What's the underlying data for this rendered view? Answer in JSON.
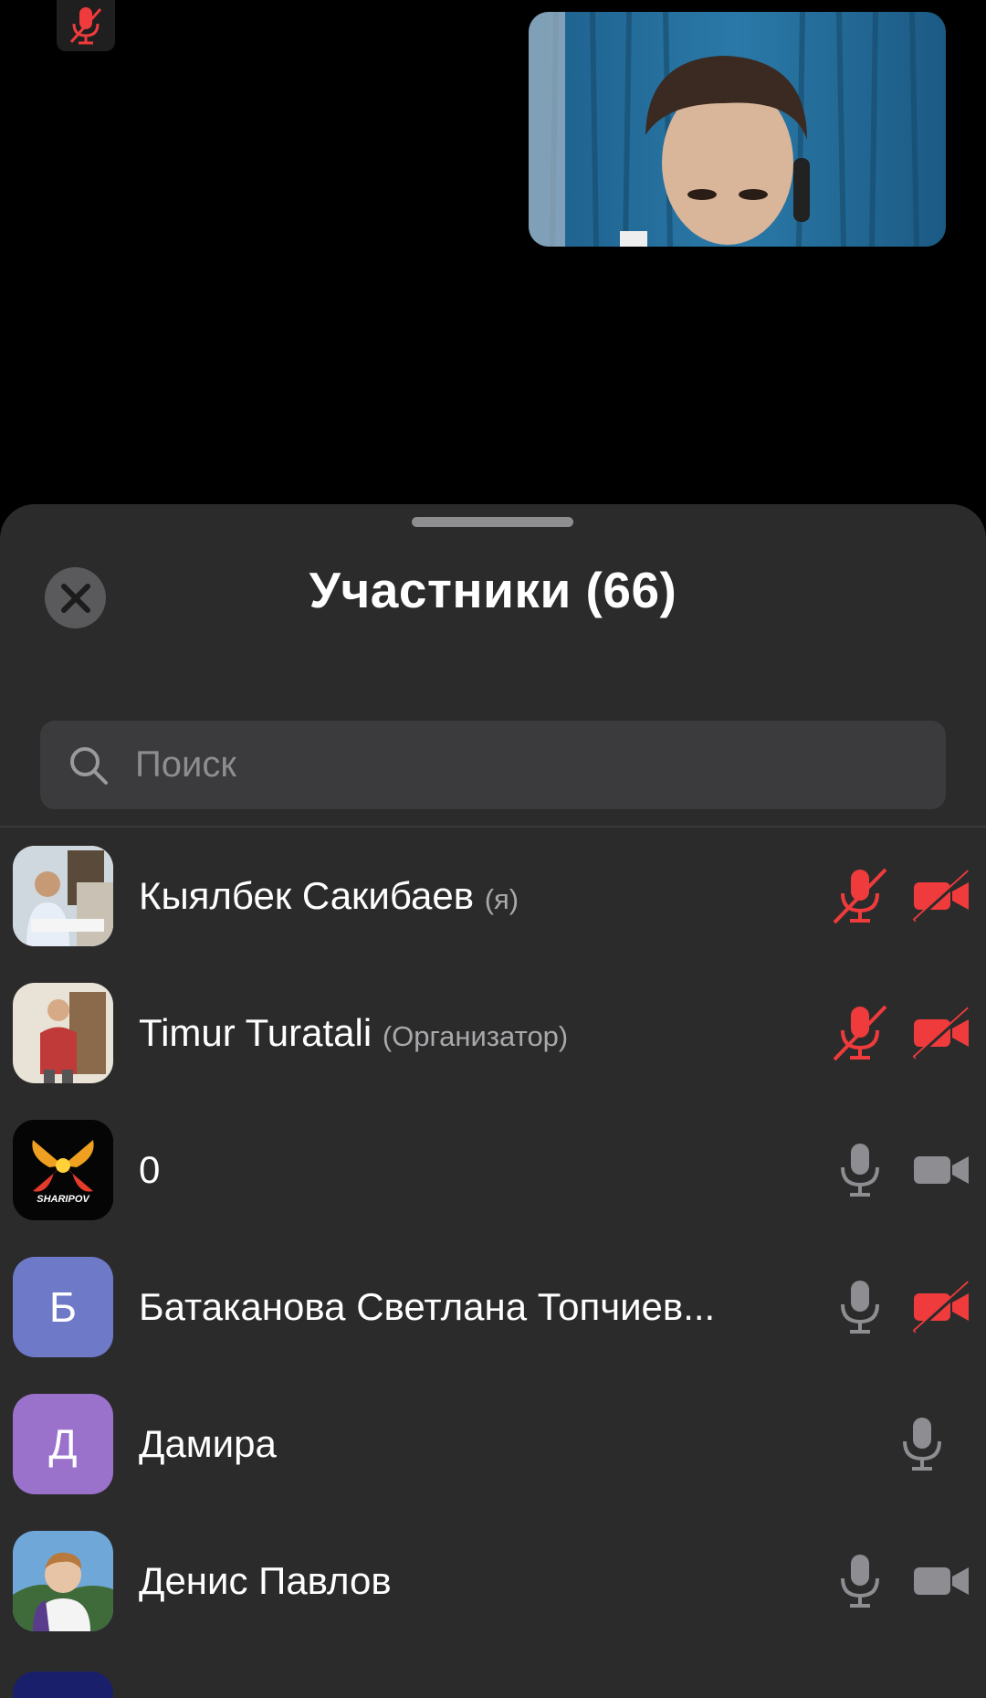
{
  "header": {
    "title": "Участники (66)"
  },
  "search": {
    "placeholder": "Поиск"
  },
  "participants": [
    {
      "name": "Кыялбек Сакибаев",
      "role": "(я)",
      "mic": "muted",
      "camera": "off",
      "avatar_type": "photo"
    },
    {
      "name": "Timur Turatali",
      "role": "(Организатор)",
      "mic": "muted",
      "camera": "off",
      "avatar_type": "photo"
    },
    {
      "name": "0",
      "role": "",
      "mic": "on",
      "camera": "on",
      "avatar_type": "logo",
      "avatar_logo_text": "SHARIPOV"
    },
    {
      "name": "Батаканова Светлана Топчиев...",
      "role": "",
      "mic": "on",
      "camera": "off",
      "avatar_type": "initial",
      "initial": "Б",
      "avatar_color": "#6e7ac8"
    },
    {
      "name": "Дамира",
      "role": "",
      "mic": "on",
      "camera": "none",
      "avatar_type": "initial",
      "initial": "Д",
      "avatar_color": "#9a72cc"
    },
    {
      "name": "Денис Павлов",
      "role": "",
      "mic": "on",
      "camera": "on",
      "avatar_type": "photo"
    }
  ],
  "colors": {
    "muted_red": "#ef3b3b",
    "icon_gray": "#8e8e92",
    "sheet_bg": "#2b2b2c"
  },
  "icons": [
    "mic-muted-icon",
    "close-icon",
    "search-icon",
    "mic-icon",
    "camera-icon",
    "camera-off-icon"
  ]
}
